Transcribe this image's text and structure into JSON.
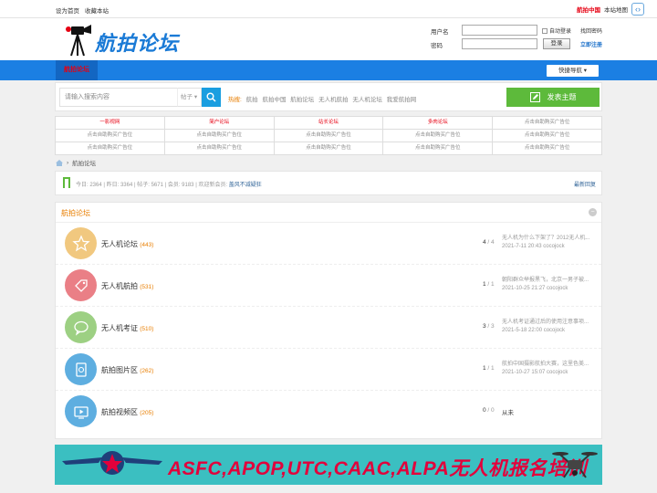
{
  "topbar": {
    "set_home": "设为首页",
    "bookmark": "收藏本站",
    "site_brand": "航拍中国",
    "sitemap": "本站地图"
  },
  "header": {
    "logo_text": "航拍论坛",
    "login": {
      "username_label": "用户名",
      "password_label": "密码",
      "auto_login": "自动登录",
      "find_password": "找回密码",
      "login_button": "登录",
      "register": "立即注册"
    }
  },
  "nav": {
    "active_tab": "航拍论坛",
    "quick_nav": "快捷导航"
  },
  "search": {
    "placeholder": "请输入搜索内容",
    "scope": "帖子",
    "hot_label": "热搜:",
    "hot_terms": [
      "航拍",
      "航拍中国",
      "航拍论坛",
      "无人机航拍",
      "无人机论坛",
      "我爱航拍网"
    ],
    "post_button": "发表主题"
  },
  "ads": [
    [
      "一影视网",
      "简户论坛",
      "站长论坛",
      "多肉论坛",
      "点击自助购买广告位"
    ],
    [
      "点击自助购买广告位",
      "点击自助购买广告位",
      "点击自助购买广告位",
      "点击自助购买广告位",
      "点击自助购买广告位"
    ],
    [
      "点击自助购买广告位",
      "点击自助购买广告位",
      "点击自助购买广告位",
      "点击自助购买广告位",
      "点击自助购买广告位"
    ]
  ],
  "breadcrumb": {
    "separator": "›",
    "current": "航拍论坛"
  },
  "stats": {
    "today_label": "今日:",
    "today": "2364",
    "yesterday_label": "昨日:",
    "yesterday": "3364",
    "posts_label": "帖子:",
    "posts": "5671",
    "members_label": "会员:",
    "members": "9183",
    "welcome_label": "欢迎新会员:",
    "new_member": "盖风不减疑狂",
    "latest_replies": "最新回复"
  },
  "forum": {
    "title": "航拍论坛",
    "collapse": "−",
    "boards": [
      {
        "name": "无人机论坛",
        "count": "(443)",
        "threads": "4",
        "posts": "4",
        "last_title": "无人机为什么下架了？2012无人机...",
        "last_meta": "2021-7-11 20:43 cocojock",
        "icon": "star-icon",
        "color": "#f1c87f"
      },
      {
        "name": "无人机航拍",
        "count": "(531)",
        "threads": "1",
        "posts": "1",
        "last_title": "朝阳群众举报黑飞，北京一男子被...",
        "last_meta": "2021-10-25 21:27 cocojock",
        "icon": "tag-icon",
        "color": "#ea7f86"
      },
      {
        "name": "无人机考证",
        "count": "(510)",
        "threads": "3",
        "posts": "3",
        "last_title": "无人机考证通过后的使用注意事项...",
        "last_meta": "2021-5-18 22:00 cocojock",
        "icon": "chat-bubble-icon",
        "color": "#9dd083"
      },
      {
        "name": "航拍图片区",
        "count": "(262)",
        "threads": "1",
        "posts": "1",
        "last_title": "航拍中国摄影航拍大赛，这里色美...",
        "last_meta": "2021-10-27 15:07 cocojock",
        "icon": "photo-album-icon",
        "color": "#5eaee0"
      },
      {
        "name": "航拍视频区",
        "count": "(205)",
        "threads": "0",
        "posts": "0",
        "last_title": "从未",
        "last_meta": "",
        "icon": "video-icon",
        "color": "#5eaee0"
      }
    ]
  },
  "banner": {
    "text": "ASFC,APOP,UTC,CAAC,ALPA无人机报名培训"
  }
}
